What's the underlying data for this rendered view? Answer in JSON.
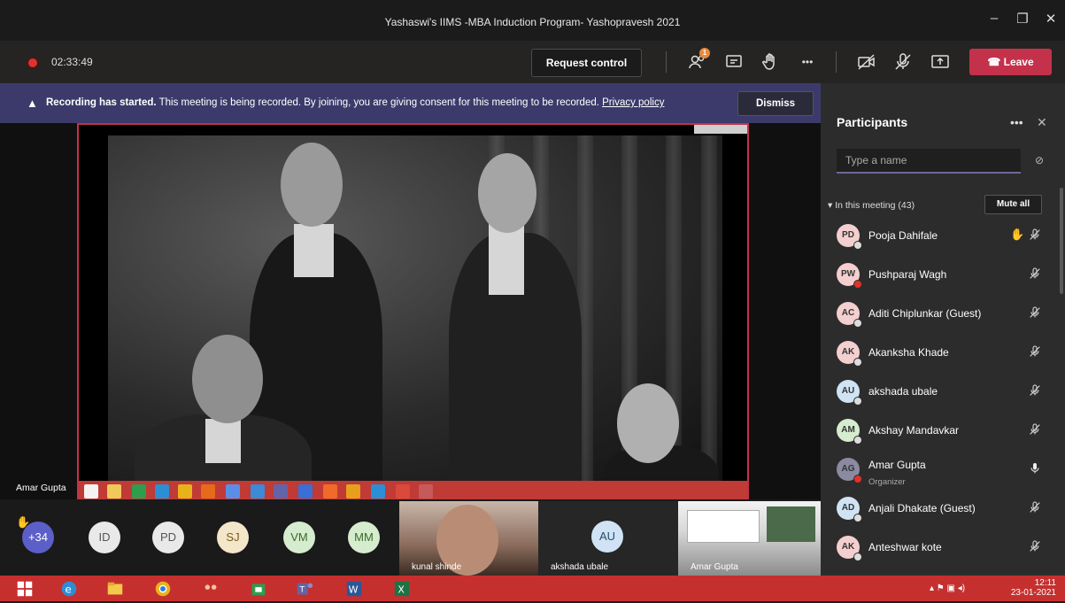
{
  "window": {
    "title": "Yashaswi's IIMS -MBA Induction Program- Yashopravesh 2021"
  },
  "toolbar": {
    "timer": "02:33:49",
    "request_control": "Request control",
    "participants_badge": "1",
    "more": "•••",
    "leave": "Leave"
  },
  "banner": {
    "bold": "Recording has started.",
    "text": " This meeting is being recorded. By joining, you are giving consent for this meeting to be recorded. ",
    "link": "Privacy policy",
    "dismiss": "Dismiss"
  },
  "stage": {
    "presenter_name": "Amar Gupta"
  },
  "strip": {
    "overflow": "+34",
    "avatars": [
      {
        "initials": "ID",
        "bg": "#e9e9e9",
        "fg": "#555"
      },
      {
        "initials": "PD",
        "bg": "#e9e9e9",
        "fg": "#555"
      },
      {
        "initials": "SJ",
        "bg": "#f3e6c9",
        "fg": "#7a5a1a"
      },
      {
        "initials": "VM",
        "bg": "#d6eccf",
        "fg": "#3a6a2a"
      },
      {
        "initials": "MM",
        "bg": "#d6eccf",
        "fg": "#3a6a2a"
      }
    ],
    "tiles": [
      {
        "name": "kunal shinde"
      },
      {
        "name": "akshada ubale",
        "initials": "AU"
      },
      {
        "name": "Amar Gupta"
      }
    ]
  },
  "panel": {
    "title": "Participants",
    "more": "•••",
    "close": "✕",
    "search_placeholder": "Type a name",
    "section": "In this meeting (43)",
    "mute_all": "Mute all",
    "participants": [
      {
        "initials": "PD",
        "name": "Pooja Dahifale",
        "bg": "#f4cfcf",
        "status": "#ddd",
        "hand": true
      },
      {
        "initials": "PW",
        "name": "Pushparaj Wagh",
        "bg": "#f4cfcf",
        "status": "#e1312d"
      },
      {
        "initials": "AC",
        "name": "Aditi Chiplunkar (Guest)",
        "bg": "#f4cfcf",
        "status": "#ddd"
      },
      {
        "initials": "AK",
        "name": "Akanksha Khade",
        "bg": "#f4cfcf",
        "status": "#ddd"
      },
      {
        "initials": "AU",
        "name": "akshada ubale",
        "bg": "#cfe3f4",
        "status": "#ddd"
      },
      {
        "initials": "AM",
        "name": "Akshay Mandavkar",
        "bg": "#d6eccf",
        "status": "#ddd"
      },
      {
        "initials": "AG",
        "name": "Amar Gupta",
        "role": "Organizer",
        "bg": "#8a8aa0",
        "status": "#e1312d",
        "mic_on": true
      },
      {
        "initials": "AD",
        "name": "Anjali Dhakate (Guest)",
        "bg": "#cfe3f4",
        "status": "#ddd"
      },
      {
        "initials": "AK",
        "name": "Anteshwar kote",
        "bg": "#f4cfcf",
        "status": "#ddd"
      }
    ]
  },
  "taskbar": {
    "time": "12:11",
    "date": "23-01-2021"
  },
  "colors": {
    "accent": "#6264a7",
    "leave": "#c4314b",
    "taskbar": "#c5302f"
  }
}
